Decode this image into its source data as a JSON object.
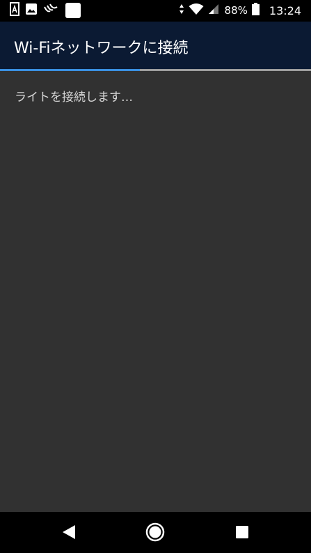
{
  "status_bar": {
    "battery": "88%",
    "time": "13:24"
  },
  "app_bar": {
    "title": "Wi-Fiネットワークに接続"
  },
  "progress": {
    "fraction": 0.45
  },
  "message": "ライトを接続します…",
  "nav": {
    "back_icon": "back-triangle-icon",
    "home_icon": "home-circle-icon",
    "recents_icon": "recents-square-icon"
  }
}
